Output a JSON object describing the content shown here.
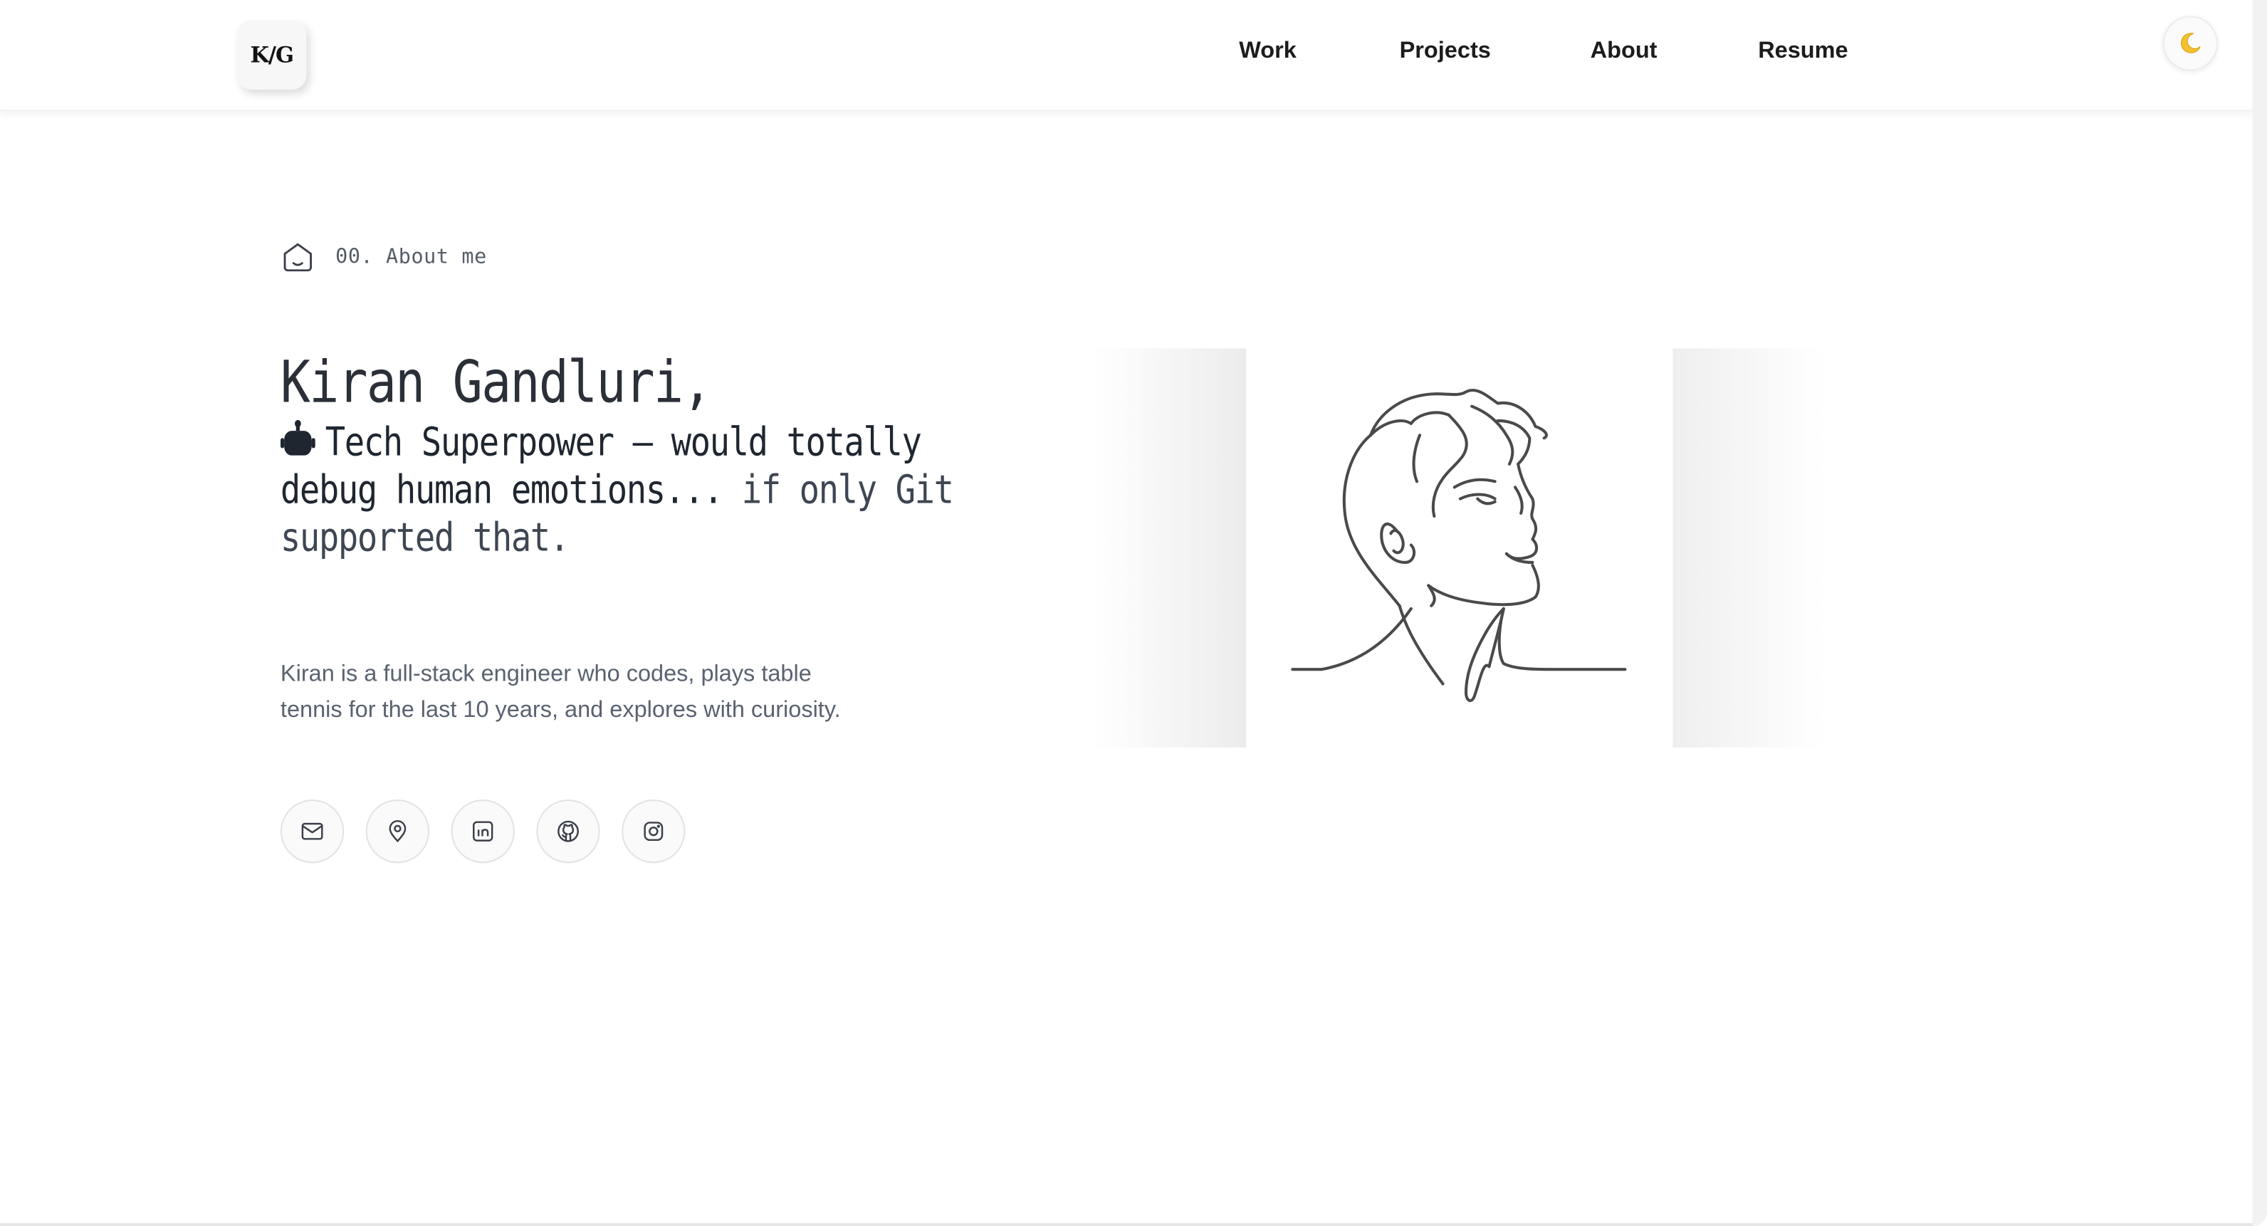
{
  "header": {
    "logo_text": "K/G",
    "nav": [
      {
        "label": "Work"
      },
      {
        "label": "Projects"
      },
      {
        "label": "About"
      },
      {
        "label": "Resume"
      }
    ],
    "theme_toggle_icon": "moon-icon"
  },
  "hero": {
    "section_label": "00. About me",
    "section_icon": "home-icon",
    "name": "Kiran Gandluri,",
    "tagline_emoji_icon": "robot-icon",
    "tagline_main": "Tech Superpower — would totally debug human emotions...",
    "tagline_muted": " if only Git supported that.",
    "bio": "Kiran is a full-stack engineer who codes, plays table tennis for the last 10 years, and explores with curiosity.",
    "portrait_icon": "line-art-portrait",
    "socials": [
      {
        "icon": "mail-icon"
      },
      {
        "icon": "location-pin-icon"
      },
      {
        "icon": "linkedin-icon"
      },
      {
        "icon": "github-icon"
      },
      {
        "icon": "instagram-icon"
      }
    ]
  },
  "colors": {
    "text_primary": "#1f2630",
    "text_muted": "#5a6270",
    "background": "#ffffff"
  }
}
